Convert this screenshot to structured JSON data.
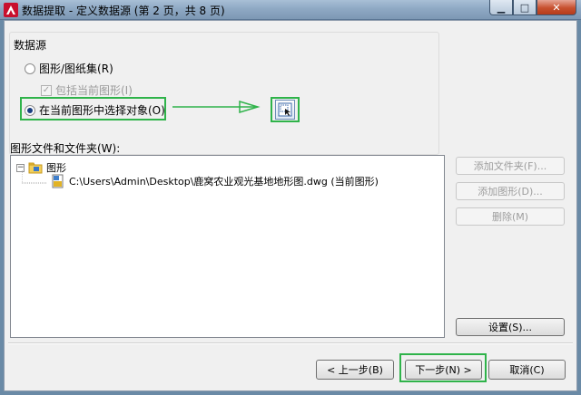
{
  "window": {
    "title": "数据提取 - 定义数据源 (第 2 页，共 8 页)",
    "controls": {
      "minimize": "▁",
      "maximize": "□",
      "close": "✕"
    }
  },
  "datasource": {
    "group_label": "数据源",
    "option_sheetset": "图形/图纸集(R)",
    "include_current": "包括当前图形(I)",
    "option_select_objects": "在当前图形中选择对象(O)"
  },
  "files": {
    "label": "图形文件和文件夹(W):",
    "tree": {
      "root": "图形",
      "child": "C:\\Users\\Admin\\Desktop\\鹿窝农业观光基地地形图.dwg (当前图形)"
    }
  },
  "side_buttons": {
    "add_folder": "添加文件夹(F)...",
    "add_drawing": "添加图形(D)...",
    "remove": "删除(M)",
    "settings": "设置(S)..."
  },
  "footer": {
    "back": "< 上一步(B)",
    "next": "下一步(N) >",
    "cancel": "取消(C)"
  },
  "colors": {
    "highlight": "#2fb34a"
  }
}
